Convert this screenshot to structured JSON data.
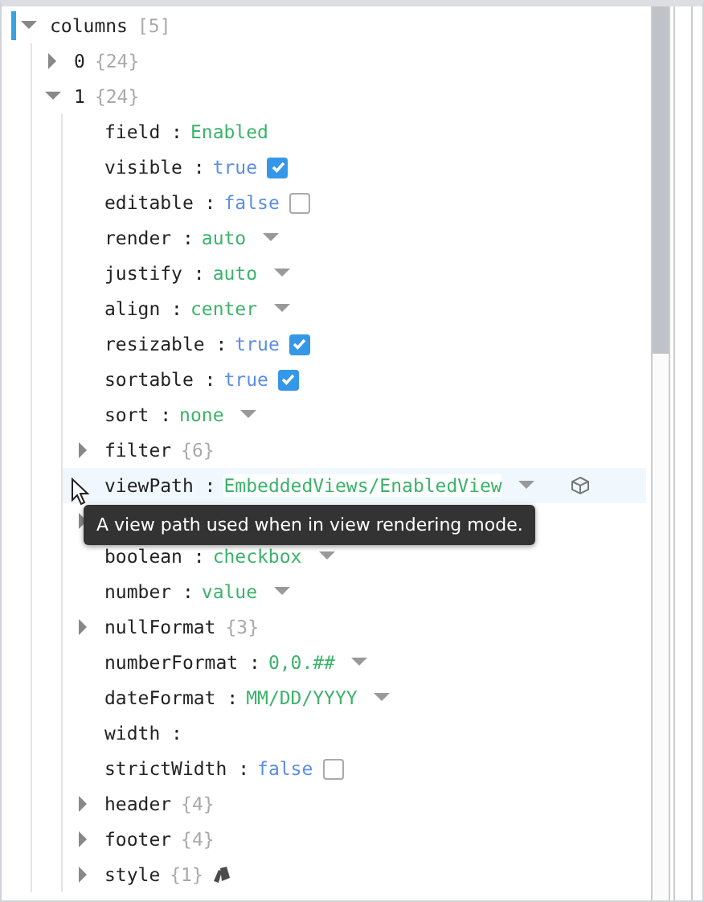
{
  "tree": [
    {
      "kind": "object",
      "key": "columns",
      "count": "[5]",
      "expanded": true,
      "selected": true,
      "children": [
        {
          "kind": "object",
          "key": "0",
          "count": "{24}",
          "expanded": false
        },
        {
          "kind": "object",
          "key": "1",
          "count": "{24}",
          "expanded": true,
          "children": [
            {
              "kind": "value",
              "key": "field :",
              "value": "Enabled"
            },
            {
              "kind": "bool",
              "key": "visible :",
              "value": "true",
              "checked": true
            },
            {
              "kind": "bool",
              "key": "editable :",
              "value": "false",
              "checked": false
            },
            {
              "kind": "enum",
              "key": "render :",
              "value": "auto"
            },
            {
              "kind": "enum",
              "key": "justify :",
              "value": "auto"
            },
            {
              "kind": "enum",
              "key": "align :",
              "value": "center"
            },
            {
              "kind": "bool",
              "key": "resizable :",
              "value": "true",
              "checked": true
            },
            {
              "kind": "bool",
              "key": "sortable :",
              "value": "true",
              "checked": true
            },
            {
              "kind": "enum",
              "key": "sort :",
              "value": "none"
            },
            {
              "kind": "object",
              "key": "filter",
              "count": "{6}",
              "expanded": false
            },
            {
              "kind": "enum",
              "key": "viewPath :",
              "value": "EmbeddedViews/EnabledView",
              "hovered": true,
              "view_icon": true,
              "tooltip": "A view path used when in view rendering mode."
            },
            {
              "kind": "object",
              "expanded": false
            },
            {
              "kind": "enum",
              "key": "boolean :",
              "value": "checkbox"
            },
            {
              "kind": "enum",
              "key": "number :",
              "value": "value"
            },
            {
              "kind": "object",
              "key": "nullFormat",
              "count": "{3}",
              "expanded": false
            },
            {
              "kind": "enum",
              "key": "numberFormat :",
              "value": "0,0.##"
            },
            {
              "kind": "enum",
              "key": "dateFormat :",
              "value": "MM/DD/YYYY"
            },
            {
              "kind": "value",
              "key": "width :"
            },
            {
              "kind": "bool",
              "key": "strictWidth :",
              "value": "false",
              "checked": false
            },
            {
              "kind": "object",
              "key": "header",
              "count": "{4}",
              "expanded": false
            },
            {
              "kind": "object",
              "key": "footer",
              "count": "{4}",
              "expanded": false
            },
            {
              "kind": "object",
              "key": "style",
              "count": "{1}",
              "expanded": false,
              "style_icon": true
            }
          ]
        }
      ]
    }
  ]
}
